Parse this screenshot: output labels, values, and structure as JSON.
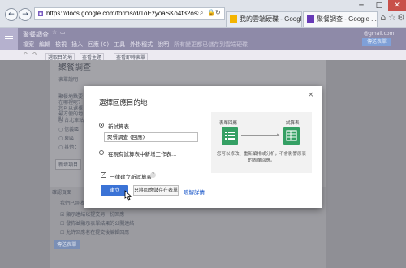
{
  "browser": {
    "back_icon": "←",
    "forward_icon": "→",
    "url": "https://docs.google.com/forms/d/1oEzyoaSKo4f32os3",
    "tabs": [
      {
        "label": "我的雲端硬碟 - Google ...",
        "favicon_color": "#f4b400"
      },
      {
        "label": "聚餐調查 - Google ...",
        "favicon_color": "#673ab7"
      }
    ],
    "win_controls": {
      "minimize": "─",
      "maximize": "□",
      "close": "✕"
    }
  },
  "forms": {
    "doc_title": "聚餐調查",
    "menu": [
      "檔案",
      "編輯",
      "檢視",
      "插入",
      "回應 (0)",
      "工具",
      "外掛程式",
      "說明"
    ],
    "save_note": "所有變更都已儲存到雲端硬碟",
    "user_email": "@gmail.com",
    "send_button": "傳送表單",
    "toolbar_items": [
      "選取目的地",
      "查看主題",
      "查看即時表單"
    ],
    "bg_title": "聚餐調查",
    "bg_desc": "表單說明",
    "bg_question": "聚餐地點要在哪裡呢？您可以選擇最方便的地點",
    "bg_options": [
      "台北車站",
      "信義區",
      "東區",
      "其他："
    ],
    "bg_section_label": "確認頁面",
    "bg_confirm": "我們已經收到您的回應。",
    "bg_checks": [
      "顯示連結以提交另一份回應",
      "發佈並顯示表單結果的公開連結",
      "允許回應者在提交後編輯回應"
    ],
    "bg_send": "傳送表單"
  },
  "dialog": {
    "title": "選擇回應目的地",
    "option_new": "新試算表",
    "sheet_name": "聚餐調查 (回應)",
    "option_existing": "在現有試算表中新增工作表...",
    "illus_form_label": "表單回應",
    "illus_sheet_label": "試算表",
    "illus_caption": "您可以修改、重新編排或分析，不會影響原表的表單回應。",
    "checkbox_label": "一律建立新試算表",
    "help_icon": "?",
    "create_button": "建立",
    "later_button": "只將回應儲存在表單",
    "learn_more": "瞭解詳情",
    "close_icon": "×"
  },
  "colors": {
    "forms_purple": "#673ab7",
    "sheets_green": "#35a064",
    "primary_blue": "#3b73d6",
    "link_blue": "#1a57c9"
  }
}
